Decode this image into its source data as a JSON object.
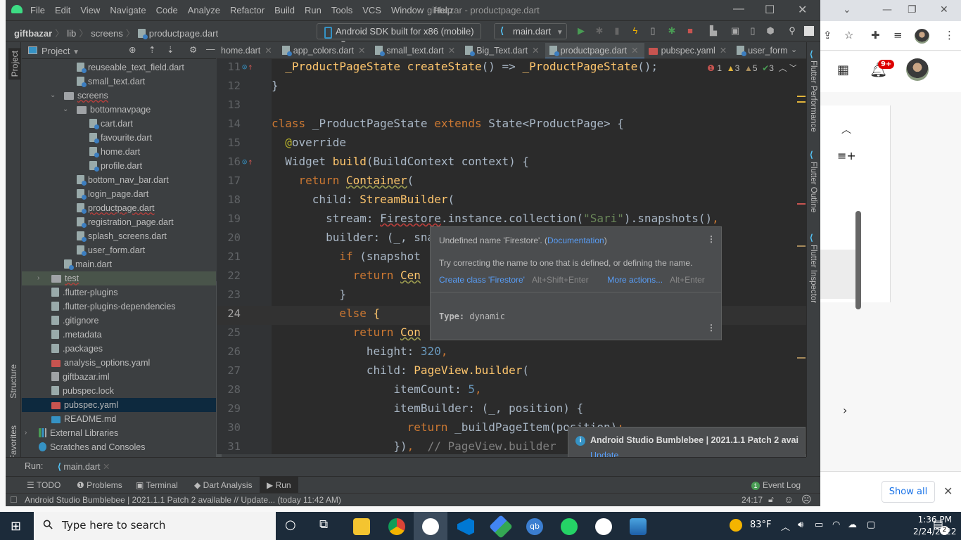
{
  "window": {
    "title": "giftbazar - productpage.dart"
  },
  "menu": [
    "File",
    "Edit",
    "View",
    "Navigate",
    "Code",
    "Analyze",
    "Refactor",
    "Build",
    "Run",
    "Tools",
    "VCS",
    "Window",
    "Help"
  ],
  "breadcrumb": {
    "project": "giftbazar",
    "items": [
      "lib",
      "screens",
      "productpage.dart"
    ]
  },
  "toolbar": {
    "device": "Android SDK built for x86 (mobile)",
    "run_config": "main.dart"
  },
  "project_panel": {
    "title": "Project",
    "items": [
      {
        "label": "reuseable_text_field.dart",
        "type": "dart",
        "depth": 4
      },
      {
        "label": "small_text.dart",
        "type": "dart",
        "depth": 4
      },
      {
        "label": "screens",
        "type": "folder",
        "depth": 3,
        "expanded": true,
        "error": true
      },
      {
        "label": "bottomnavpage",
        "type": "folder",
        "depth": 4,
        "expanded": true
      },
      {
        "label": "cart.dart",
        "type": "dart",
        "depth": 5
      },
      {
        "label": "favourite.dart",
        "type": "dart",
        "depth": 5
      },
      {
        "label": "home.dart",
        "type": "dart",
        "depth": 5
      },
      {
        "label": "profile.dart",
        "type": "dart",
        "depth": 5
      },
      {
        "label": "bottom_nav_bar.dart",
        "type": "dart",
        "depth": 4
      },
      {
        "label": "login_page.dart",
        "type": "dart",
        "depth": 4
      },
      {
        "label": "productpage.dart",
        "type": "dart",
        "depth": 4,
        "error": true
      },
      {
        "label": "registration_page.dart",
        "type": "dart",
        "depth": 4
      },
      {
        "label": "splash_screens.dart",
        "type": "dart",
        "depth": 4
      },
      {
        "label": "user_form.dart",
        "type": "dart",
        "depth": 4
      },
      {
        "label": "main.dart",
        "type": "dart",
        "depth": 3
      },
      {
        "label": "test",
        "type": "folder",
        "depth": 2,
        "expanded": false,
        "error": true
      },
      {
        "label": ".flutter-plugins",
        "type": "file",
        "depth": 2
      },
      {
        "label": ".flutter-plugins-dependencies",
        "type": "file",
        "depth": 2
      },
      {
        "label": ".gitignore",
        "type": "file",
        "depth": 2
      },
      {
        "label": ".metadata",
        "type": "file",
        "depth": 2
      },
      {
        "label": ".packages",
        "type": "file",
        "depth": 2
      },
      {
        "label": "analysis_options.yaml",
        "type": "yml",
        "depth": 2
      },
      {
        "label": "giftbazar.iml",
        "type": "iml",
        "depth": 2
      },
      {
        "label": "pubspec.lock",
        "type": "file",
        "depth": 2
      },
      {
        "label": "pubspec.yaml",
        "type": "yml",
        "depth": 2,
        "selected": true
      },
      {
        "label": "README.md",
        "type": "md",
        "depth": 2
      },
      {
        "label": "External Libraries",
        "type": "lib",
        "depth": 1,
        "expanded": false
      },
      {
        "label": "Scratches and Consoles",
        "type": "scratch",
        "depth": 1
      }
    ]
  },
  "left_strip": {
    "project": "Project",
    "structure": "Structure",
    "favorites": "Favorites"
  },
  "editor_tabs": [
    {
      "label": "home.dart"
    },
    {
      "label": "app_colors.dart"
    },
    {
      "label": "small_text.dart"
    },
    {
      "label": "Big_Text.dart"
    },
    {
      "label": "productpage.dart",
      "active": true
    },
    {
      "label": "pubspec.yaml"
    },
    {
      "label": "user_form"
    }
  ],
  "inspections": {
    "errors": "1",
    "warnings": "3",
    "weak_warnings": "5",
    "typos": "3"
  },
  "code_lines": [
    {
      "n": "11",
      "html": "  <span class='fn'>_ProductPageState</span> <span class='fn'>createState</span>() => <span class='fn'>_ProductPageState</span>();",
      "override": true
    },
    {
      "n": "12",
      "html": "}"
    },
    {
      "n": "13",
      "html": ""
    },
    {
      "n": "14",
      "html": "<span class='kw'>class</span> _ProductPageState <span class='kw'>extends</span> State&lt;ProductPage&gt; {"
    },
    {
      "n": "15",
      "html": "  <span class='ann'>@</span>override"
    },
    {
      "n": "16",
      "html": "  Widget <span class='fn'>build</span>(BuildContext context) {",
      "override": true
    },
    {
      "n": "17",
      "html": "    <span class='kw'>return</span> <span class='fn wavyy'>Container</span>("
    },
    {
      "n": "18",
      "html": "      child: <span class='fn'>StreamBuilder</span>("
    },
    {
      "n": "19",
      "html": "        stream: <span class='wavy'>Firestore</span>.instance.collection(<span class='str'>\"Sari\"</span>).snapshots()<span class='kw'>,</span>"
    },
    {
      "n": "20",
      "html": "        builder: (_, snapshot) {"
    },
    {
      "n": "21",
      "html": "          <span class='kw'>if</span> (snapshot"
    },
    {
      "n": "22",
      "html": "            <span class='kw'>return</span> <span class='fn wavyy'>Cen</span>"
    },
    {
      "n": "23",
      "html": "          }"
    },
    {
      "n": "24",
      "html": "          <span class='kw'>else</span> <span class='fn'>{</span>",
      "current": true
    },
    {
      "n": "25",
      "html": "            <span class='kw'>return</span> <span class='fn wavyy'>Con</span>"
    },
    {
      "n": "26",
      "html": "              height: <span class='num'>320</span><span class='kw'>,</span>"
    },
    {
      "n": "27",
      "html": "              child: <span class='fn'>PageView.builder</span>("
    },
    {
      "n": "28",
      "html": "                  itemCount: <span class='num'>5</span><span class='kw'>,</span>"
    },
    {
      "n": "29",
      "html": "                  itemBuilder: (_, position) {"
    },
    {
      "n": "30",
      "html": "                    <span class='kw'>return</span> _buildPageItem(position)<span class='kw'>;</span>"
    },
    {
      "n": "31",
      "html": "                  })<span class='kw'>,</span>  <span class='cm'>// PageView.builder</span>"
    }
  ],
  "tooltip": {
    "message": "Undefined name 'Firestore'. (",
    "doc_link": "Documentation",
    "message_end": ")",
    "hint": "Try correcting the name to one that is defined, or defining the name.",
    "action1": "Create class 'Firestore'",
    "action1_shortcut": "Alt+Shift+Enter",
    "action2": "More actions...",
    "action2_shortcut": "Alt+Enter",
    "type_label": "Type:",
    "type_value": "dynamic"
  },
  "right_strip": [
    "Flutter Performance",
    "Flutter Outline",
    "Flutter Inspector"
  ],
  "notification": {
    "title": "Android Studio Bumblebee | 2021.1.1 Patch 2 avai",
    "link": "Update..."
  },
  "run_bar": {
    "label": "Run:",
    "config": "main.dart"
  },
  "tool_windows": [
    "TODO",
    "Problems",
    "Terminal",
    "Dart Analysis",
    "Run"
  ],
  "event_log": {
    "count": "1",
    "label": "Event Log"
  },
  "status": {
    "message": "Android Studio Bumblebee | 2021.1.1 Patch 2 available // Update... (today 11:42 AM)",
    "position": "24:17"
  },
  "browser": {
    "notif_count": "9+",
    "show_all": "Show all"
  },
  "taskbar": {
    "search_placeholder": "Type here to search",
    "weather": "83°F",
    "time": "1:36 PM",
    "date": "2/24/2022",
    "notifications": "2"
  }
}
